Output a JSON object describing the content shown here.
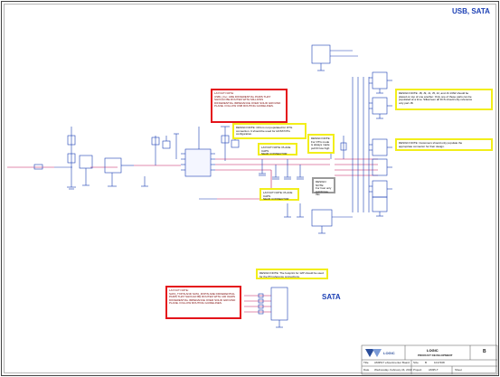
{
  "sheet": {
    "title": "USB, SATA",
    "sata_label": "SATA"
  },
  "notes": {
    "layout_usb": "LAYOUT NOTE:\nUSBn_D+/- ARE DIFFERENTIAL PAIRS THAT\nSHOULD BE ROUTED WITH MILLIONS\nDIFFERENTIAL IMPEDANCE OVER SOLID GROUND\nPLANE. FOLLOW USB ROUTING GUIDELINES.",
    "design_cfg": "DESIGN NOTE: CFG is not populated for OTG\nconnection. It should be used for HOST/OTG\nconfiguration.",
    "layout_place_host": "LAYOUT NOTE: PLACE CAPS\nNEAR CONNECTOR",
    "design_otg": "DESIGN NOTE:\nFor OTG mode\nis always made\npull ID low high",
    "design_pull": "DESIGN NOTE:\nFor host only\npull ID low this",
    "layout_place_conn": "LAYOUT NOTE: PLACE CAPS\nNEAR CONNECTOR",
    "design_jumpers": "DESIGN NOTE: J8, J9, J1, J5, J2, and J4 1/4W should be\nplaced on top of one another. Only one of these parts can be\npopulated at a time. Silkscreen all FCS should only reference\nonly part J8.",
    "design_customer": "DESIGN NOTE: Customers should only populate the\nappropriate connector for their design.",
    "design_sata": "DESIGN NOTE: The footprint for 12P should be used\nfor the PN reference connections.",
    "layout_sata": "LAYOUT NOTE:\nSATA_TXP/N AND SATA_RXP/N ARE DIFFERENTIAL\nPAIRS THAT SHOULD BE ROUTED WITH 100 OHMS\nDIFFERENTIAL IMPEDANCE OVER SOLID GROUND\nPLANE. FOLLOW ROUTING GUIDELINES."
  },
  "title_block": {
    "company": "LOGIC",
    "department": "PRODUCT DEVELOPMENT",
    "title": "AM3517 eXperimenter Board",
    "title_label": "Title",
    "size_label": "Size",
    "size": "B",
    "doc_number": "1017468",
    "date_label": "Date",
    "date": "Wednesday, February 24, 2010",
    "sheet_label": "Sheet",
    "project_label": "Project",
    "project": "AM35-T",
    "rev": "B",
    "logo_text": "LOGIC"
  },
  "colors": {
    "line": "#1b3fb4",
    "net": "#c2185b",
    "red": "#e4141b",
    "yellow": "#f2ee1a",
    "gray": "#9a9a9a",
    "text": "#1b3fb4"
  }
}
